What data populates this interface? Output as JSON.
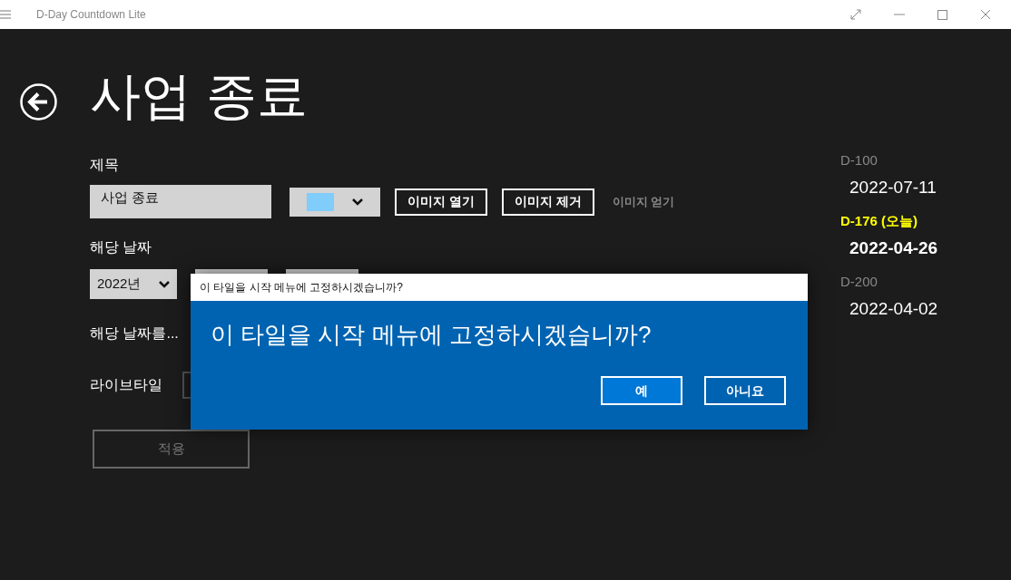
{
  "window": {
    "title": "D-Day Countdown Lite"
  },
  "page": {
    "title": "사업 종료"
  },
  "form": {
    "title_label": "제목",
    "title_value": "사업 종료",
    "color_picker": {
      "color": "#80ccfa"
    },
    "buttons": [
      {
        "label": "이미지 열기",
        "enabled": true
      },
      {
        "label": "이미지 제거",
        "enabled": true
      },
      {
        "label": "이미지 얻기",
        "enabled": false
      }
    ],
    "date_label": "해당 날짜",
    "year": "2022년",
    "repeat_label": "해당 날짜를...",
    "livetile_label": "라이브타일",
    "apply_button": {
      "label": "적용",
      "enabled": false
    }
  },
  "countdowns": [
    {
      "label": "D-100",
      "date": "2022-07-11",
      "selected": false
    },
    {
      "label": "D-176 (오늘)",
      "date": "2022-04-26",
      "selected": true
    },
    {
      "label": "D-200",
      "date": "2022-04-02",
      "selected": false
    }
  ],
  "dialog": {
    "title": "이 타일을 시작 메뉴에 고정하시겠습니까?",
    "message": "이 타일을 시작 메뉴에 고정하시겠습니까?",
    "buttons": [
      {
        "label": "예",
        "primary": true
      },
      {
        "label": "아니요",
        "primary": false
      }
    ]
  }
}
